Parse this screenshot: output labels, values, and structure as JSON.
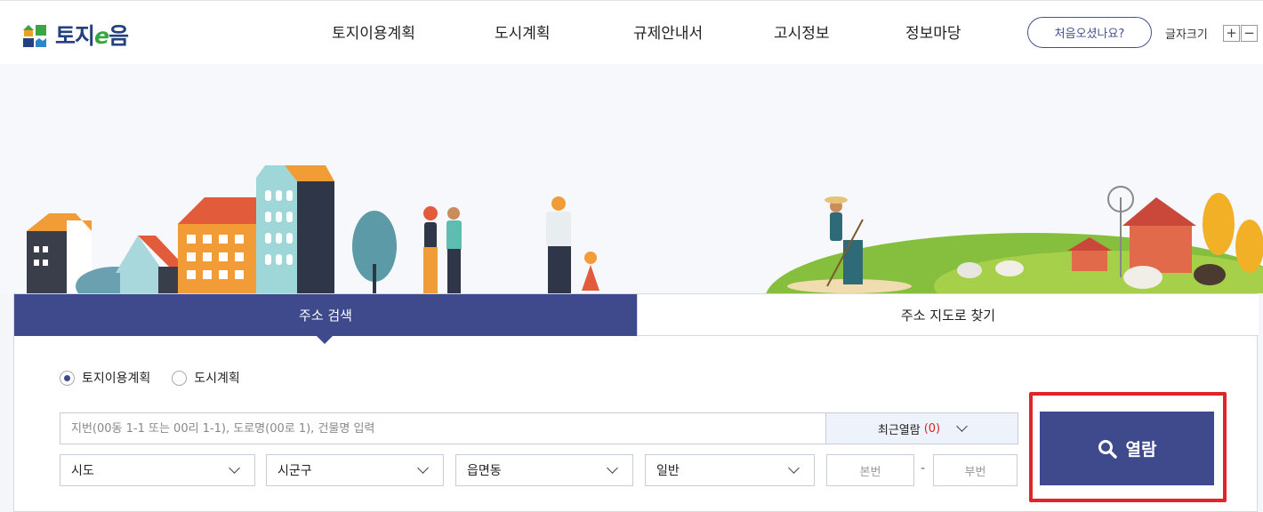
{
  "header": {
    "logo": "토지e음",
    "nav": [
      "토지이용계획",
      "도시계획",
      "규제안내서",
      "고시정보",
      "정보마당"
    ],
    "first_visit": "처음오셨나요?",
    "font_size_label": "글자크기",
    "font_plus": "+",
    "font_minus": "−"
  },
  "tabs": {
    "address_search": "주소 검색",
    "map_search": "주소 지도로 찾기"
  },
  "radios": {
    "land_use": "토지이용계획",
    "urban_plan": "도시계획",
    "selected": "land_use"
  },
  "search": {
    "placeholder": "지번(00동 1-1 또는 00리 1-1), 도로명(00로 1), 건물명 입력",
    "recent_label": "최근열람",
    "recent_count": "(0)"
  },
  "selects": {
    "sido": "시도",
    "sigungu": "시군구",
    "eupmyeondong": "읍면동",
    "type": "일반"
  },
  "lot": {
    "main_placeholder": "본번",
    "sub_placeholder": "부번",
    "separator": "-"
  },
  "view_button": "열람",
  "colors": {
    "primary": "#3e4a8c",
    "highlight": "#e1232a",
    "logo_blue": "#23407f",
    "logo_green": "#3aa543"
  }
}
